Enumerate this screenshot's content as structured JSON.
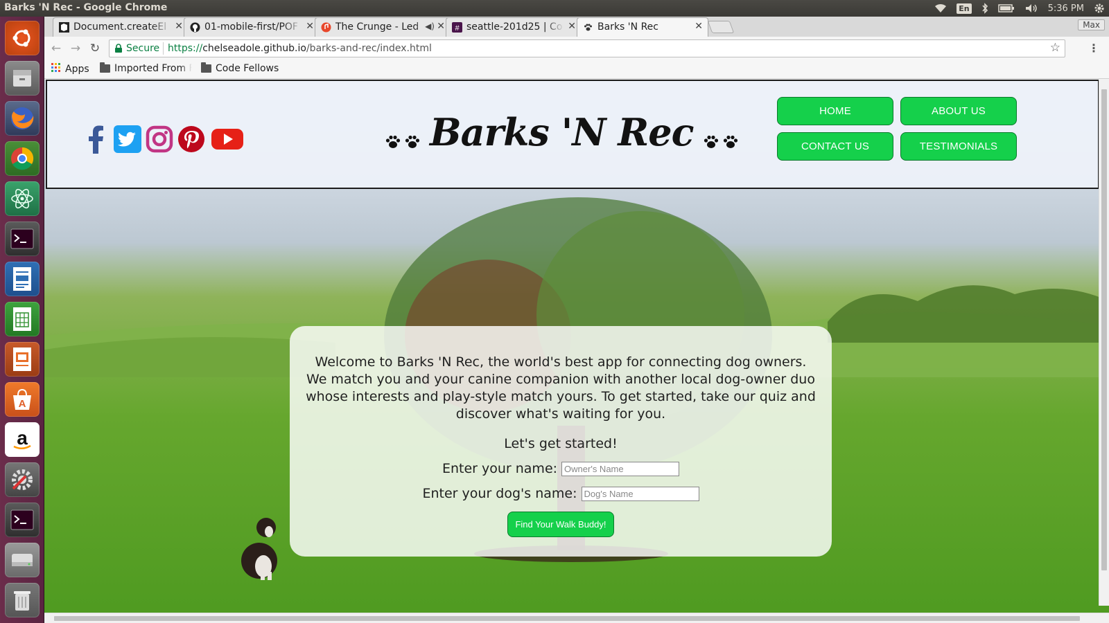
{
  "system": {
    "window_title": "Barks 'N Rec - Google Chrome",
    "keyboard_layout": "En",
    "clock": "5:36 PM",
    "icons": [
      "wifi-icon",
      "bluetooth-icon",
      "battery-icon",
      "volume-icon",
      "settings-gear-icon"
    ]
  },
  "launcher": {
    "items": [
      {
        "name": "ubuntu-dash"
      },
      {
        "name": "files"
      },
      {
        "name": "firefox"
      },
      {
        "name": "chrome"
      },
      {
        "name": "atom"
      },
      {
        "name": "terminal"
      },
      {
        "name": "writer"
      },
      {
        "name": "calc"
      },
      {
        "name": "impress"
      },
      {
        "name": "software-center"
      },
      {
        "name": "amazon"
      },
      {
        "name": "system-settings"
      },
      {
        "name": "terminal-2"
      },
      {
        "name": "disk"
      },
      {
        "name": "trash"
      }
    ]
  },
  "browser": {
    "tabs": [
      {
        "label": "Document.createEl",
        "favicon": "code-fellows-icon"
      },
      {
        "label": "01-mobile-first/POF",
        "favicon": "github-icon"
      },
      {
        "label": "The Crunge - Led",
        "favicon": "audio-icon"
      },
      {
        "label": "seattle-201d25 | Co",
        "favicon": "slack-icon"
      },
      {
        "label": "Barks 'N Rec",
        "favicon": "paw-icon"
      }
    ],
    "max_label": "Max",
    "secure_label": "Secure",
    "url_scheme": "https://",
    "url_host": "chelseadole.github.io",
    "url_path": "/barks-and-rec/index.html",
    "bookmarks": [
      {
        "label": "Apps"
      },
      {
        "label": "Imported From F"
      },
      {
        "label": "Code Fellows"
      }
    ]
  },
  "site": {
    "title": "Barks 'N Rec",
    "social_icons": [
      "facebook-icon",
      "twitter-icon",
      "instagram-icon",
      "pinterest-icon",
      "youtube-icon"
    ],
    "nav": [
      "HOME",
      "ABOUT US",
      "CONTACT US",
      "TESTIMONIALS"
    ],
    "colors": {
      "nav_green": "#15d04b",
      "facebook": "#3b5998",
      "twitter": "#1da1f2",
      "instagram": "#c13584",
      "pinterest": "#bd081c",
      "youtube": "#e62117"
    },
    "welcome": "Welcome to Barks 'N Rec, the world's best app for connecting dog owners. We match you and your canine companion with another local dog-owner duo whose interests and play-style match yours. To get started, take our quiz and discover what's waiting for you.",
    "start": "Let's get started!",
    "owner_label": "Enter your name:",
    "owner_placeholder": "Owner's Name",
    "dog_label": "Enter your dog's name:",
    "dog_placeholder": "Dog's Name",
    "button": "Find Your Walk Buddy!"
  }
}
